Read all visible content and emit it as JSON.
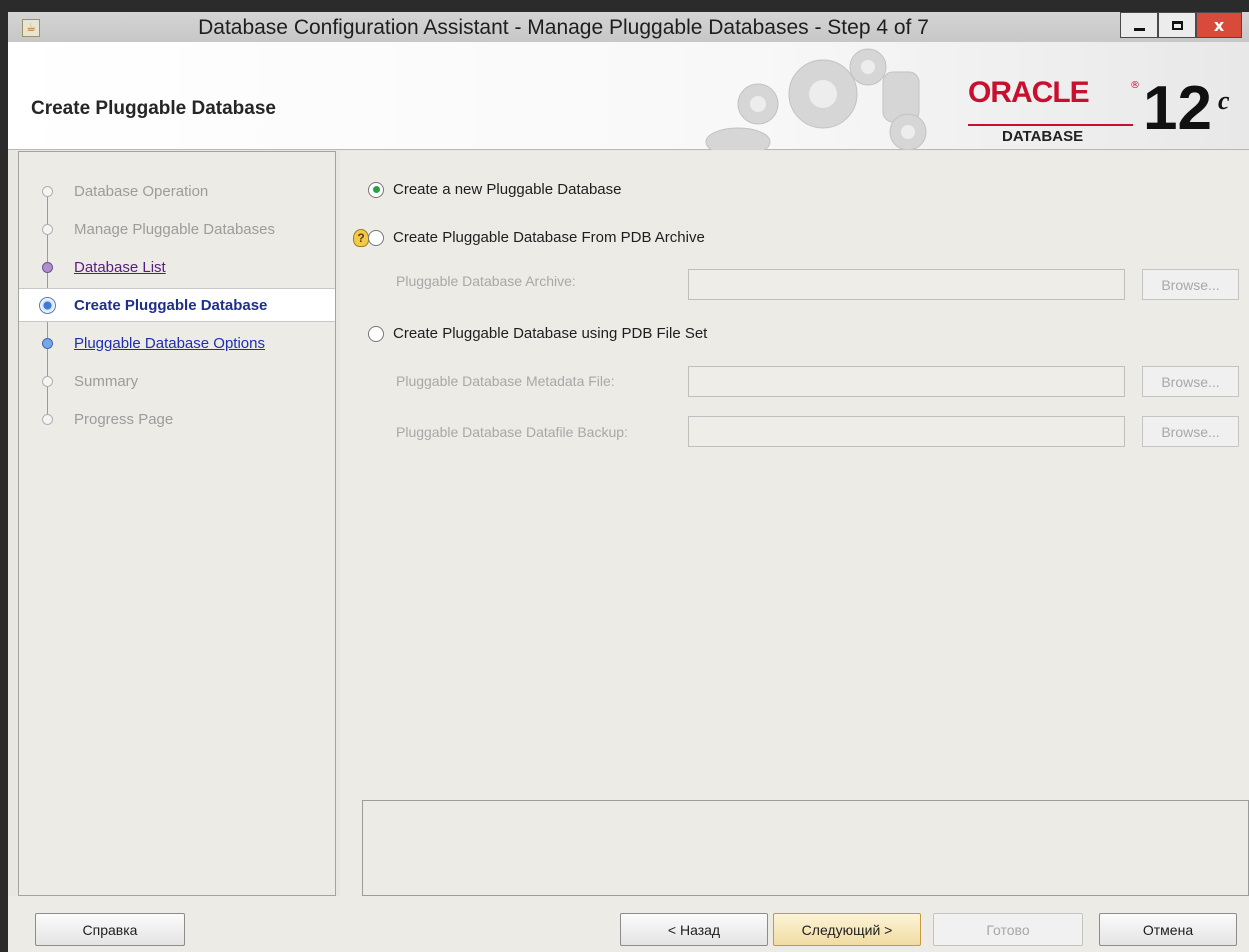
{
  "window": {
    "title": "Database Configuration Assistant - Manage Pluggable Databases - Step 4 of 7",
    "app_icon": "java-icon",
    "controls": [
      "minimize-icon",
      "maximize-icon",
      "close-icon"
    ],
    "close_label": "x"
  },
  "header": {
    "page_title": "Create Pluggable Database",
    "logo_text": "ORACLE",
    "logo_sub": "DATABASE",
    "version": "12",
    "version_suffix": "c"
  },
  "steps": [
    {
      "label": "Database Operation",
      "state": "disabled"
    },
    {
      "label": "Manage Pluggable Databases",
      "state": "disabled"
    },
    {
      "label": "Database List",
      "state": "visited"
    },
    {
      "label": "Create Pluggable Database",
      "state": "current"
    },
    {
      "label": "Pluggable Database Options",
      "state": "link"
    },
    {
      "label": "Summary",
      "state": "disabled"
    },
    {
      "label": "Progress Page",
      "state": "disabled"
    }
  ],
  "options": {
    "new_pdb": {
      "label": "Create a new Pluggable Database",
      "selected": true
    },
    "from_archive": {
      "label": "Create Pluggable Database From PDB Archive",
      "selected": false,
      "archive_label": "Pluggable Database Archive:",
      "archive_value": "",
      "browse_label": "Browse..."
    },
    "file_set": {
      "label": "Create Pluggable Database using PDB File Set",
      "selected": false,
      "metadata_label": "Pluggable Database Metadata File:",
      "metadata_value": "",
      "datafile_label": "Pluggable Database Datafile Backup:",
      "datafile_value": "",
      "browse_label": "Browse..."
    }
  },
  "buttons": {
    "help": "Справка",
    "back": "< Назад",
    "next": "Следующий >",
    "finish": "Готово",
    "cancel": "Отмена"
  }
}
